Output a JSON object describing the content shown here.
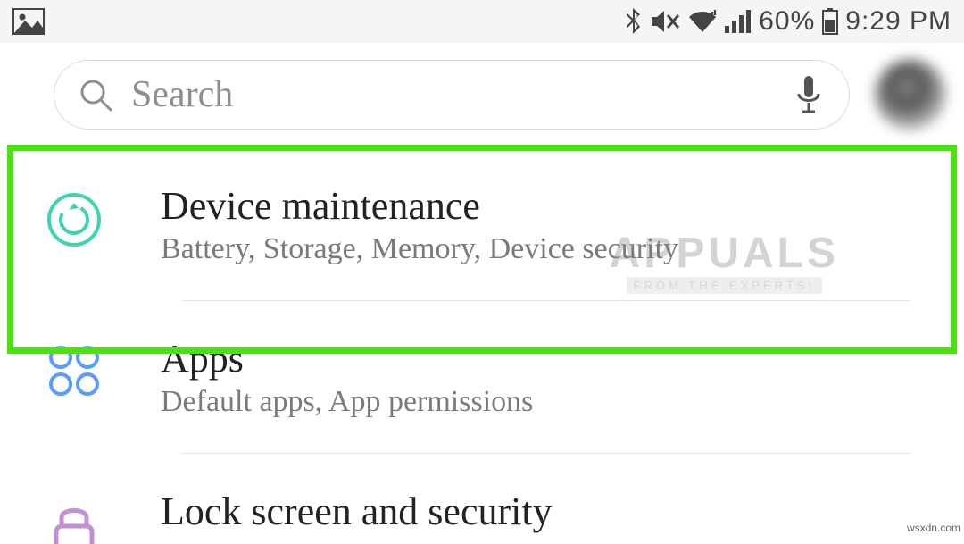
{
  "status": {
    "battery_percent": "60%",
    "time": "9:29 PM"
  },
  "search": {
    "placeholder": "Search"
  },
  "items": [
    {
      "title": "Device maintenance",
      "subtitle": "Battery, Storage, Memory, Device security"
    },
    {
      "title": "Apps",
      "subtitle": "Default apps, App permissions"
    },
    {
      "title": "Lock screen and security",
      "subtitle": ""
    }
  ],
  "watermark": {
    "line1": "APPUALS",
    "line2": "FROM THE EXPERTS!"
  },
  "source": "wsxdn.com"
}
